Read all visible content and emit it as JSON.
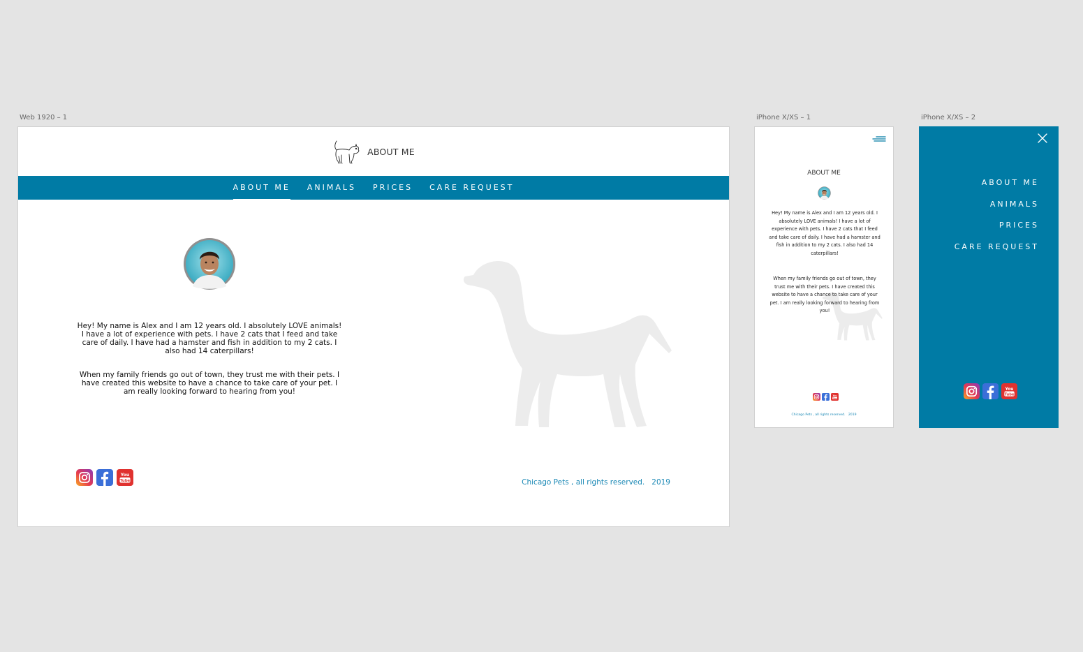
{
  "canvas": {
    "labels": {
      "web": "Web 1920 – 1",
      "phone1": "iPhone X/XS – 1",
      "phone2": "iPhone X/XS – 2"
    }
  },
  "site": {
    "page_title": "ABOUT ME",
    "nav": {
      "items": [
        "ABOUT ME",
        "ANIMALS",
        "PRICES",
        "CARE REQUEST"
      ],
      "active_index": 0
    },
    "bio": {
      "paragraph1": "Hey! My name is Alex and I am 12 years old. I absolutely LOVE animals! I have a lot of experience with pets. I have 2 cats that I feed and take care of daily. I have had a hamster and fish in addition to my 2 cats. I also had 14 caterpillars!",
      "paragraph2": "When my family friends go out of town, they trust me with their pets. I have created this website to have a chance to take care of your pet. I am really looking forward to hearing from you!"
    },
    "footer": "Chicago Pets , all rights reserved.   2019",
    "socials": [
      "instagram-icon",
      "facebook-icon",
      "youtube-icon"
    ]
  },
  "colors": {
    "brand_blue": "#007ba5",
    "footer_text": "#1a88b5",
    "dog_silhouette": "#ececec",
    "canvas_bg": "#e4e4e4"
  },
  "icons": {
    "logo": "cat-logo-icon",
    "menu": "hamburger-menu-icon",
    "close": "close-icon"
  }
}
